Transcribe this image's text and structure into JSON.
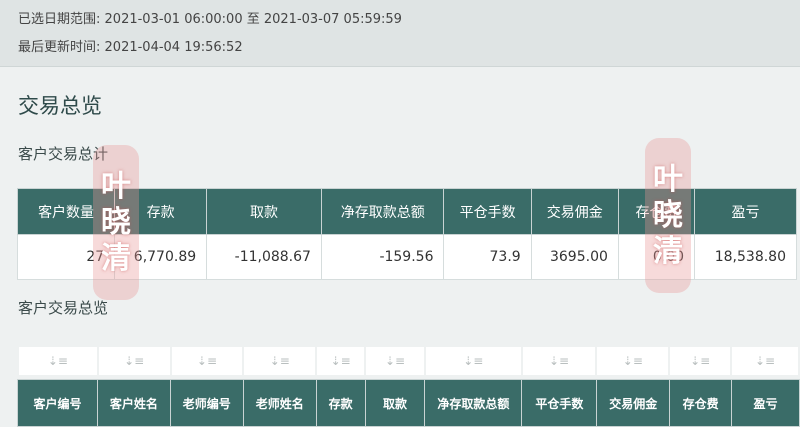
{
  "header": {
    "range_label": "已选日期范围:",
    "range_value": "2021-03-01 06:00:00 至 2021-03-07 05:59:59",
    "updated_label": "最后更新时间:",
    "updated_value": "2021-04-04 19:56:52"
  },
  "page_title": "交易总览",
  "summary": {
    "title": "客户交易总计",
    "columns": [
      "客户数量",
      "存款",
      "取款",
      "净存取款总额",
      "平仓手数",
      "交易佣金",
      "存仓费",
      "盈亏"
    ],
    "row": [
      "27",
      "6,770.89",
      "-11,088.67",
      "-159.56",
      "73.9",
      "3695.00",
      "0.00",
      "18,538.80"
    ]
  },
  "overview": {
    "title": "客户交易总览",
    "sort_icon": "sort-icon",
    "columns": [
      "客户编号",
      "客户姓名",
      "老师编号",
      "老师姓名",
      "存款",
      "取款",
      "净存取款总额",
      "平仓手数",
      "交易佣金",
      "存仓费",
      "盈亏"
    ]
  },
  "watermark": {
    "text": [
      "叶",
      "晓",
      "清"
    ]
  },
  "colors": {
    "header_bg": "#3a6c68",
    "page_bg": "#eef1f1"
  }
}
